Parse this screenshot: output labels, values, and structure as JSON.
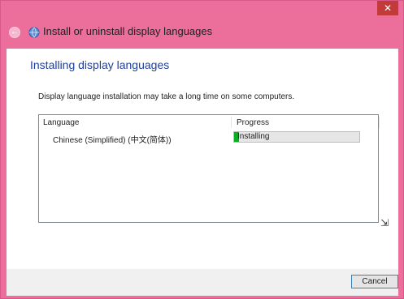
{
  "window": {
    "title": "Install or uninstall display languages",
    "close_glyph": "✕"
  },
  "nav": {
    "back_glyph": "←"
  },
  "main": {
    "heading": "Installing display languages",
    "description": "Display language installation may take a long time on some computers.",
    "table": {
      "columns": [
        "Language",
        "Progress"
      ],
      "rows": [
        {
          "language": "Chinese (Simplified) (中文(简体))",
          "status": "Installing",
          "progress": 0.04
        }
      ]
    }
  },
  "footer": {
    "cancel_label": "Cancel"
  },
  "colors": {
    "frame": "#ec6f9b",
    "heading": "#1f3f9c",
    "progress_fill": "#06b025"
  }
}
